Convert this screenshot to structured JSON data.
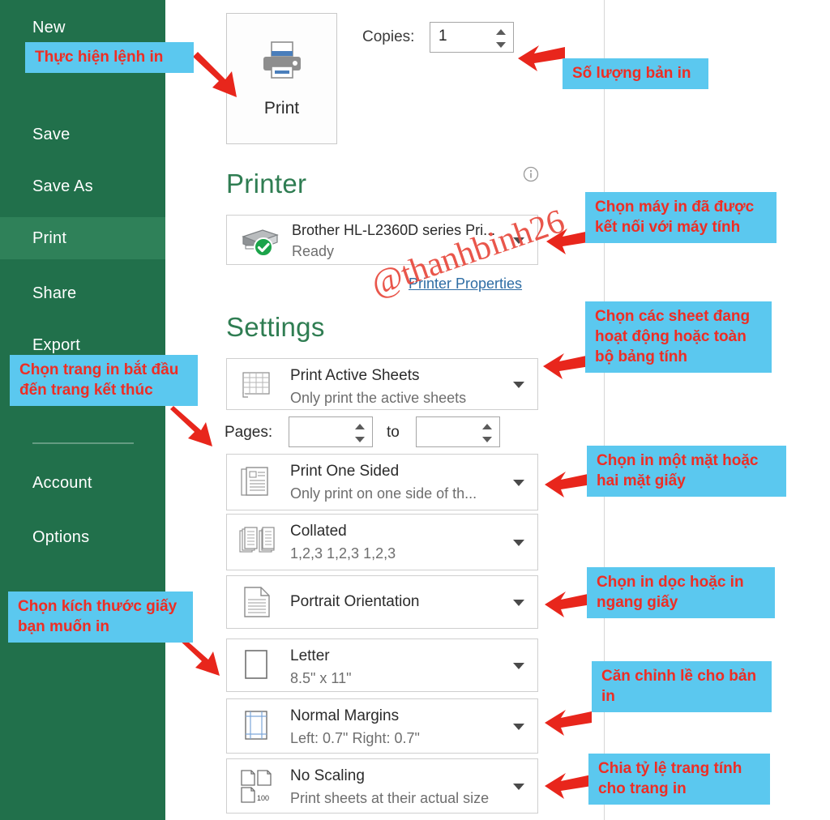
{
  "sidebar": {
    "items": [
      {
        "label": "New",
        "active": false
      },
      {
        "label": "Save",
        "active": false
      },
      {
        "label": "Save As",
        "active": false
      },
      {
        "label": "Print",
        "active": true
      },
      {
        "label": "Share",
        "active": false
      },
      {
        "label": "Export",
        "active": false
      },
      {
        "label": "Account",
        "active": false
      },
      {
        "label": "Options",
        "active": false
      }
    ]
  },
  "print_button": {
    "label": "Print",
    "icon": "printer-icon"
  },
  "copies": {
    "label": "Copies:",
    "value": "1"
  },
  "printer": {
    "heading": "Printer",
    "name": "Brother HL-L2360D series Pri...",
    "status": "Ready",
    "properties_link": "Printer Properties",
    "info_icon": "info-circle-icon"
  },
  "settings": {
    "heading": "Settings",
    "pages": {
      "label": "Pages:",
      "to_label": "to",
      "from_value": "",
      "to_value": ""
    },
    "combos": [
      {
        "id": "sheets",
        "title": "Print Active Sheets",
        "sub": "Only print the active sheets",
        "icon": "worksheet-icon"
      },
      {
        "id": "sided",
        "title": "Print One Sided",
        "sub": "Only print on one side of th...",
        "icon": "one-sided-icon"
      },
      {
        "id": "collated",
        "title": "Collated",
        "sub": "1,2,3   1,2,3   1,2,3",
        "icon": "collated-icon"
      },
      {
        "id": "orient",
        "title": "Portrait Orientation",
        "sub": "",
        "icon": "portrait-icon"
      },
      {
        "id": "paper",
        "title": "Letter",
        "sub": "8.5\" x 11\"",
        "icon": "paper-size-icon"
      },
      {
        "id": "margins",
        "title": "Normal Margins",
        "sub": "Left:  0.7\"   Right:  0.7\"",
        "icon": "margins-icon"
      },
      {
        "id": "scaling",
        "title": "No Scaling",
        "sub": "Print sheets at their actual size",
        "icon": "scaling-icon"
      }
    ]
  },
  "annotations": [
    {
      "id": "exec-print",
      "text": "Thực hiện lệnh in"
    },
    {
      "id": "copies-count",
      "text": "Số lượng bản in"
    },
    {
      "id": "pick-printer",
      "text": "Chọn máy in đã được\nkết nối với máy tính"
    },
    {
      "id": "page-range",
      "text": "Chọn trang in bắt đầu\nđến trang kết thúc"
    },
    {
      "id": "pick-sheets",
      "text": "Chọn các sheet đang\nhoạt động hoặc toàn\nbộ bảng tính"
    },
    {
      "id": "sides",
      "text": "Chọn in một mặt hoặc\nhai mặt giấy"
    },
    {
      "id": "orientation",
      "text": "Chọn in dọc hoặc in\nngang giấy"
    },
    {
      "id": "paper-size",
      "text": "Chọn kích thước giấy\nbạn muốn in"
    },
    {
      "id": "margins-note",
      "text": "Căn chỉnh lề cho bản\nin"
    },
    {
      "id": "scaling-note",
      "text": "Chia tỷ lệ trang tính\ncho trang in"
    }
  ],
  "watermark": {
    "text": "@thanhbinh26"
  },
  "colors": {
    "sidebar_green": "#21704b",
    "sidebar_active": "#2f8159",
    "heading_green": "#2f7d52",
    "callout_bg": "#5bc8ef",
    "callout_text": "#ee2d24",
    "link_blue": "#2e6da4",
    "arrow_red": "#e8261c"
  }
}
